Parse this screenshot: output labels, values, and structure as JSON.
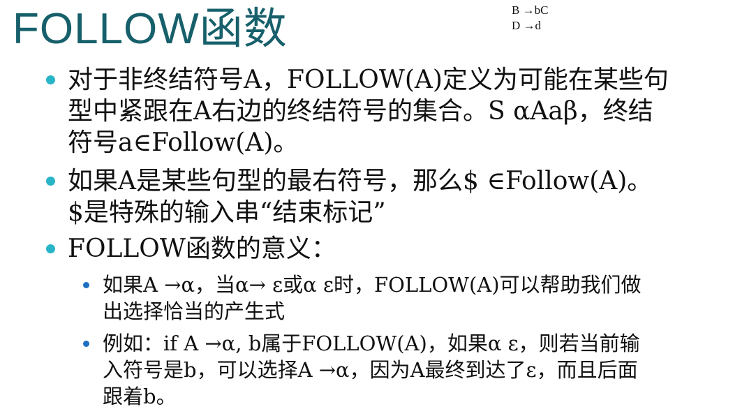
{
  "title": "FOLLOW函数",
  "grammar": [
    "B →bC",
    "D →d"
  ],
  "bullets": [
    {
      "lines": [
        "对于非终结符号A，FOLLOW(A)定义为可能在某些句",
        "型中紧跟在A右边的终结符号的集合。S  αAaβ，终结",
        "符号a∈Follow(A)。"
      ]
    },
    {
      "lines": [
        "如果A是某些句型的最右符号，那么$ ∈Follow(A)。",
        "$是特殊的输入串“结束标记”"
      ]
    },
    {
      "lines": [
        "FOLLOW函数的意义："
      ]
    }
  ],
  "sub_bullets": [
    {
      "lines": [
        "如果A →α，当α→ ε或α  ε时，FOLLOW(A)可以帮助我们做",
        "出选择恰当的产生式"
      ]
    },
    {
      "lines": [
        "例如：if A →α, b属于FOLLOW(A)，如果α  ε，则若当前输",
        "入符号是b，可以选择A →α，因为A最终到达了ε，而且后面",
        "跟着b。"
      ]
    }
  ],
  "colors": {
    "title": "#17606b",
    "level1_bullet": "#29b5c8",
    "level2_bullet": "#1e6fc0"
  }
}
